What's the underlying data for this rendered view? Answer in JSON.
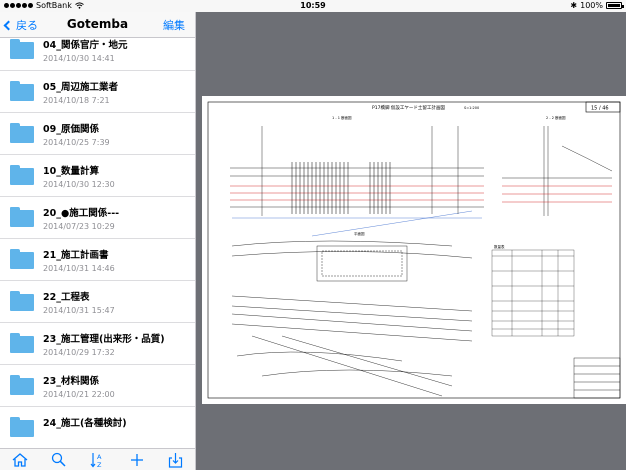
{
  "status_bar": {
    "carrier": "SoftBank",
    "time": "10:59",
    "battery": "100%"
  },
  "navbar": {
    "back_label": "戻る",
    "title": "Gotemba",
    "edit_label": "編集"
  },
  "folders": [
    {
      "name": "04_関係官庁・地元",
      "date": "2014/10/30 14:41"
    },
    {
      "name": "05_周辺施工業者",
      "date": "2014/10/18 7:21"
    },
    {
      "name": "09_原価関係",
      "date": "2014/10/25 7:39"
    },
    {
      "name": "10_数量計算",
      "date": "2014/10/30 12:30"
    },
    {
      "name": "20_●施工関係---",
      "date": "2014/07/23 10:29"
    },
    {
      "name": "21_施工計画書",
      "date": "2014/10/31 14:46"
    },
    {
      "name": "22_工程表",
      "date": "2014/10/31 15:47"
    },
    {
      "name": "23_施工管理(出来形・品質)",
      "date": "2014/10/29 17:32"
    },
    {
      "name": "23_材料関係",
      "date": "2014/10/21 22:00"
    },
    {
      "name": "24_施工(各種検討)",
      "date": ""
    }
  ],
  "toolbar": {
    "icons": [
      "home-icon",
      "search-icon",
      "sort-az-icon",
      "add-icon",
      "download-icon"
    ],
    "sort_label": "AZ"
  },
  "document": {
    "title": "P17橋脚 仮設工ヤード土留工計画図",
    "page": "15 / 46",
    "scale": "S=1:200",
    "section_1": "1 - 1 断面図",
    "section_2": "2 - 2 断面図",
    "plan_label": "平面図",
    "table_title": "数量表"
  },
  "colors": {
    "accent": "#007aff",
    "folder": "#5fb4ea",
    "viewer_bg": "#6d6f75"
  }
}
